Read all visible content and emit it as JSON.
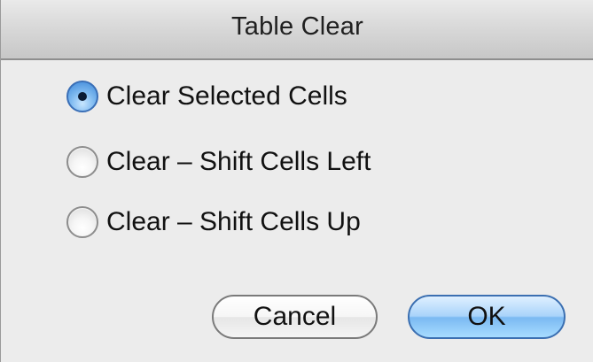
{
  "dialog": {
    "title": "Table Clear",
    "options": [
      {
        "label": "Clear Selected Cells",
        "selected": true
      },
      {
        "label": "Clear – Shift Cells Left",
        "selected": false
      },
      {
        "label": "Clear – Shift Cells Up",
        "selected": false
      }
    ],
    "buttons": {
      "cancel_label": "Cancel",
      "ok_label": "OK"
    }
  },
  "colors": {
    "window_bg": "#ececec",
    "default_button_accent": "#7bb9f2",
    "selected_radio_accent": "#3d87d8"
  }
}
